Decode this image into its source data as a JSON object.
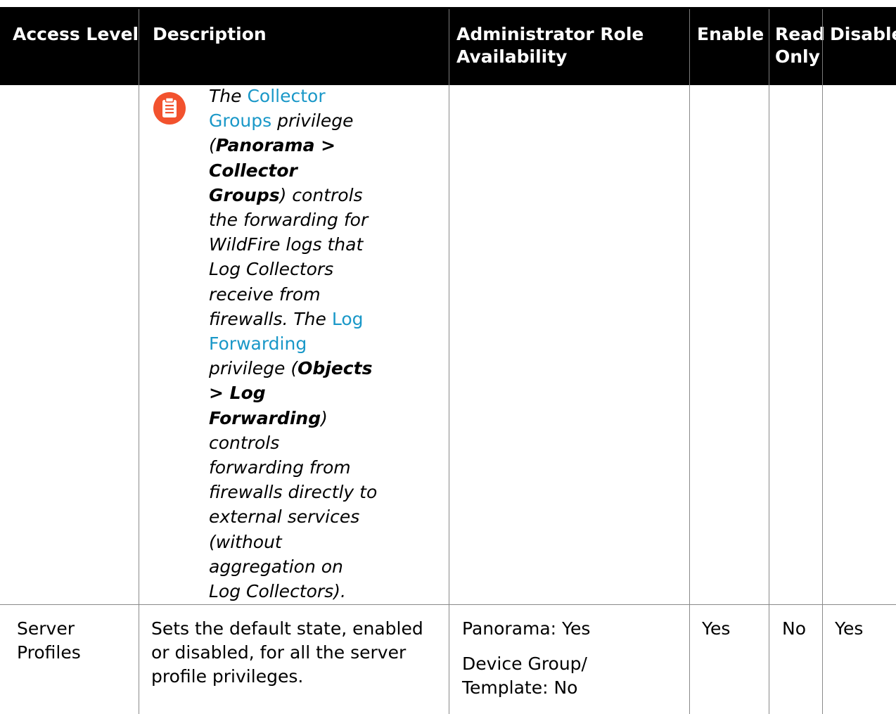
{
  "table": {
    "headers": {
      "access_level": "Access Level",
      "description": "Description",
      "role_availability": "Administrator Role Availability",
      "enable": "Enable",
      "read_only": "Read Only",
      "disable": "Disable"
    },
    "note": {
      "icon": "clipboard-note-icon",
      "icon_color": "#f2522e",
      "link_color": "#1a98c8",
      "t1": "The ",
      "link1": "Collector Groups",
      "t2": " privilege (",
      "b1": "Panorama > Collector Groups",
      "t3": ") controls the forwarding for WildFire logs that Log Collectors receive from firewalls. The ",
      "link2": "Log Forwarding",
      "t4": " privilege (",
      "b2": "Objects > Log Forwarding",
      "t5": ") controls forwarding from firewalls directly to external services (without aggregation on Log Collectors)."
    },
    "rows": [
      {
        "access_level": "Server Profiles",
        "description": "Sets the default state, enabled or disabled, for all the server profile privileges.",
        "availability_panorama": "Panorama: Yes",
        "availability_dg": "Device Group/ Template: No",
        "enable": "Yes",
        "read_only": "No",
        "disable": "Yes"
      }
    ]
  }
}
